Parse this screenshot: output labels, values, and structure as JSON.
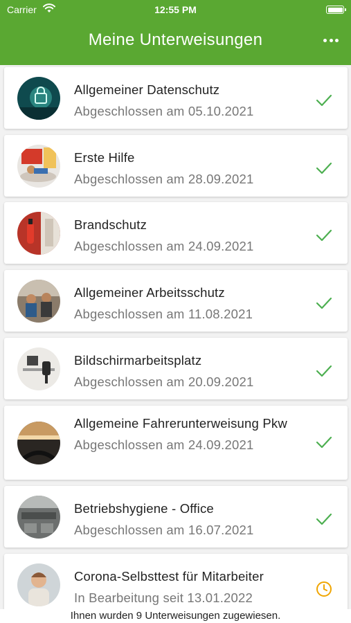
{
  "status_bar": {
    "carrier": "Carrier",
    "time": "12:55 PM"
  },
  "header": {
    "title": "Meine Unterweisungen",
    "more_icon": "more-horizontal-icon"
  },
  "accent_color": "#5aa832",
  "items": [
    {
      "title": "Allgemeiner Datenschutz",
      "subtitle": "Abgeschlossen am 05.10.2021",
      "status": "completed",
      "status_icon": "checkmark-icon"
    },
    {
      "title": "Erste Hilfe",
      "subtitle": "Abgeschlossen am 28.09.2021",
      "status": "completed",
      "status_icon": "checkmark-icon"
    },
    {
      "title": "Brandschutz",
      "subtitle": "Abgeschlossen am 24.09.2021",
      "status": "completed",
      "status_icon": "checkmark-icon"
    },
    {
      "title": "Allgemeiner Arbeitsschutz",
      "subtitle": "Abgeschlossen am 11.08.2021",
      "status": "completed",
      "status_icon": "checkmark-icon"
    },
    {
      "title": "Bildschirmarbeitsplatz",
      "subtitle": "Abgeschlossen am 20.09.2021",
      "status": "completed",
      "status_icon": "checkmark-icon"
    },
    {
      "title": "Allgemeine Fahrerunterweisung Pkw",
      "subtitle": "Abgeschlossen am 24.09.2021",
      "status": "completed",
      "status_icon": "checkmark-icon"
    },
    {
      "title": "Betriebshygiene - Office",
      "subtitle": "Abgeschlossen am 16.07.2021",
      "status": "completed",
      "status_icon": "checkmark-icon"
    },
    {
      "title": "Corona-Selbsttest für Mitarbeiter",
      "subtitle": "In Bearbeitung seit 13.01.2022",
      "status": "in_progress",
      "status_icon": "clock-icon"
    }
  ],
  "status_colors": {
    "completed": "#4caf50",
    "in_progress": "#f0a500"
  },
  "footer": {
    "text": "Ihnen wurden 9 Unterweisungen zugewiesen."
  }
}
